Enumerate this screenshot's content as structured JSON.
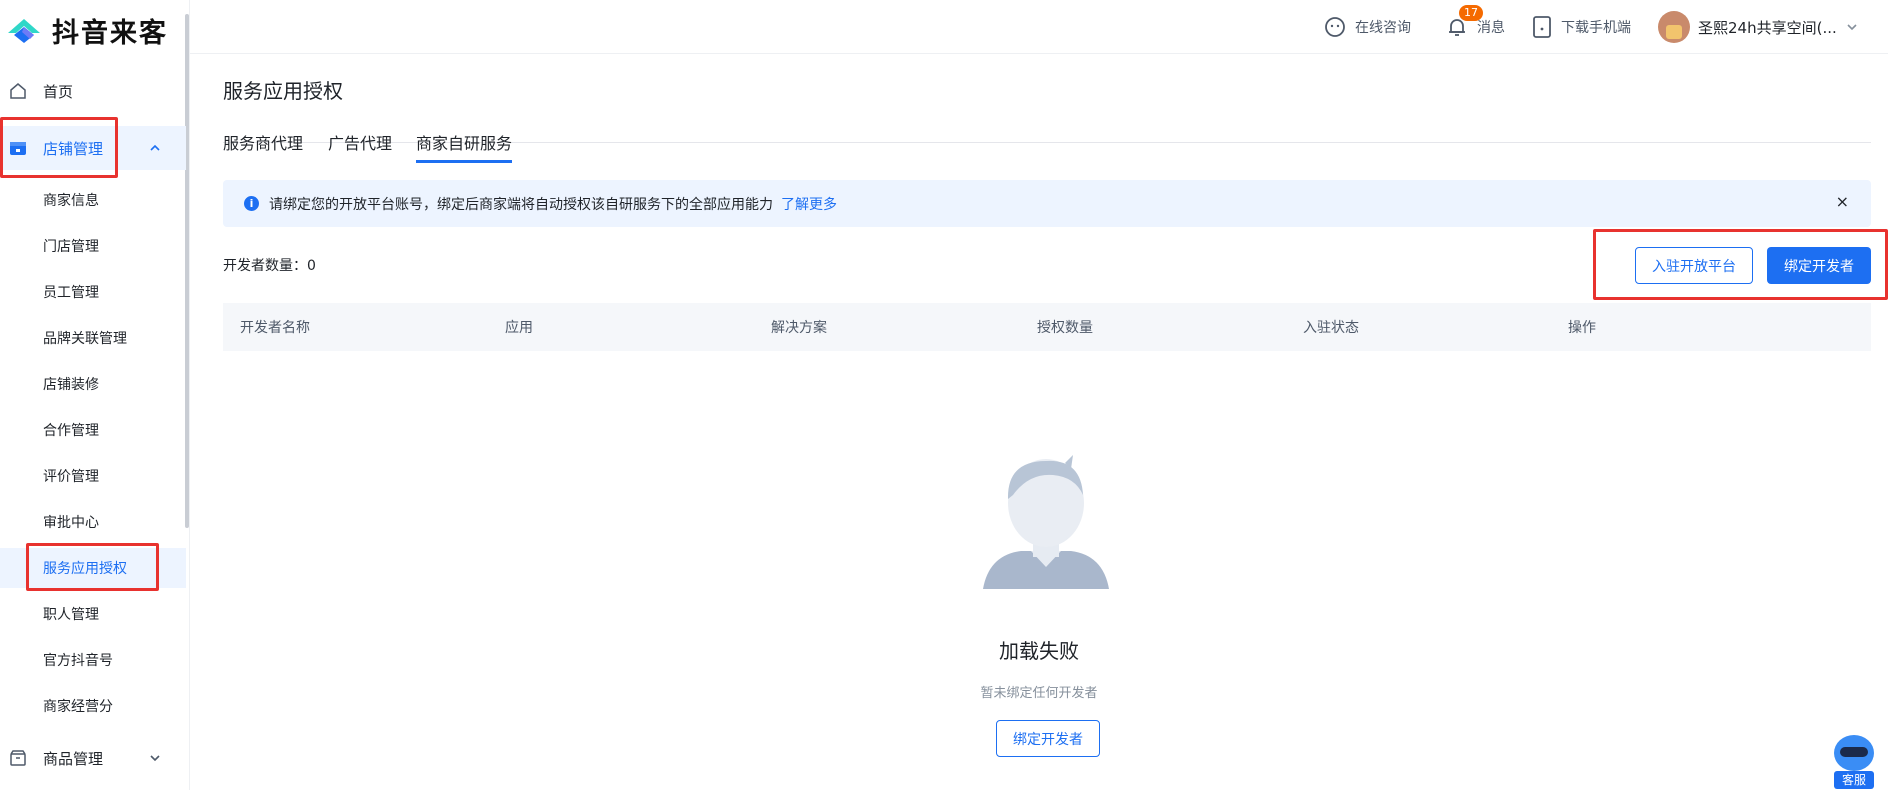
{
  "app": {
    "name": "抖音来客",
    "brand_color": "#1d6ff2",
    "alert_red": "#e8322f"
  },
  "sidebar": {
    "home": "首页",
    "store_mgmt": "店铺管理",
    "store_items": [
      "商家信息",
      "门店管理",
      "员工管理",
      "品牌关联管理",
      "店铺装修",
      "合作管理",
      "评价管理",
      "审批中心",
      "服务应用授权",
      "职人管理",
      "官方抖音号",
      "商家经营分"
    ],
    "product_mgmt": "商品管理"
  },
  "header": {
    "consult": "在线咨询",
    "messages": "消息",
    "message_count": "17",
    "download": "下载手机端",
    "account": "圣熙24h共享空间(..."
  },
  "page": {
    "title": "服务应用授权",
    "tabs": [
      "服务商代理",
      "广告代理",
      "商家自研服务"
    ],
    "active_tab": "商家自研服务",
    "alert": {
      "message": "请绑定您的开放平台账号，绑定后商家端将自动授权该自研服务下的全部应用能力",
      "link": "了解更多",
      "close": "×"
    },
    "dev_count": "开发者数量：0",
    "btn_join": "入驻开放平台",
    "btn_bind": "绑定开发者",
    "table_headers": [
      "开发者名称",
      "应用",
      "解决方案",
      "授权数量",
      "入驻状态",
      "操作"
    ],
    "empty": {
      "title": "加载失败",
      "subtitle": "暂未绑定任何开发者",
      "button": "绑定开发者"
    },
    "customer_service": "客服"
  }
}
